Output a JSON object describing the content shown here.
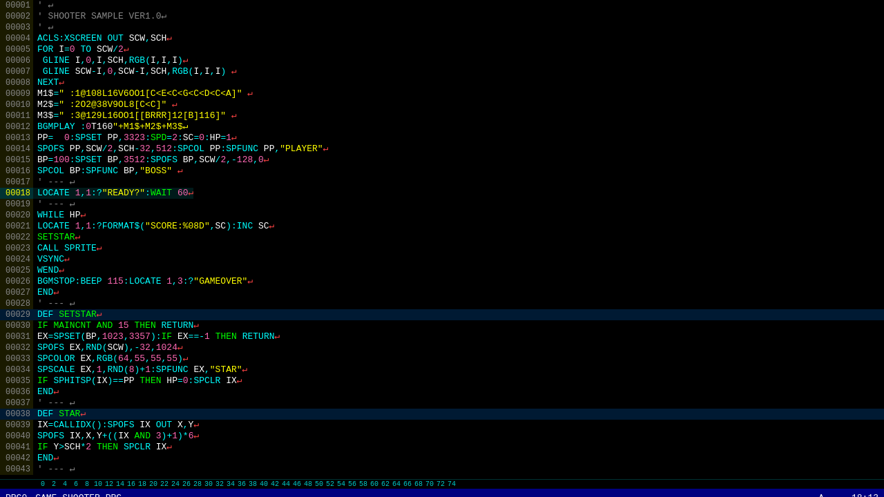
{
  "editor": {
    "title": "GAME_SHOOTER.PRG",
    "program": "PRG0",
    "cursor": {
      "line": 18,
      "col": 13
    },
    "status_right": "A",
    "time": "18:13"
  },
  "ruler": {
    "marks": [
      "0",
      "2",
      "4",
      "6",
      "8",
      "10",
      "12",
      "14",
      "16",
      "18",
      "20",
      "22",
      "24",
      "26",
      "28",
      "30",
      "32",
      "34",
      "36",
      "38",
      "40",
      "42",
      "44",
      "46",
      "48",
      "50",
      "52",
      "54",
      "56",
      "58",
      "60",
      "62",
      "64",
      "66",
      "68",
      "70",
      "72",
      "74"
    ]
  },
  "lines": [
    {
      "num": "00001",
      "content": "' ↵",
      "highlight": false,
      "def": false
    },
    {
      "num": "2",
      "content": "' SHOOTER SAMPLE VER1.0↵",
      "highlight": false,
      "def": false
    },
    {
      "num": "3",
      "content": "' ↵",
      "highlight": false,
      "def": false
    },
    {
      "num": "4",
      "content": "ACLS:XSCREEN OUT SCW,SCH↵",
      "highlight": false,
      "def": false
    },
    {
      "num": "5",
      "content": "FOR I=0 TO SCW/2↵",
      "highlight": false,
      "def": false
    },
    {
      "num": "6",
      "content": " GLINE I,0,I,SCH,RGB(I,I,I)↵",
      "highlight": false,
      "def": false
    },
    {
      "num": "7",
      "content": " GLINE SCW-I,0,SCW-I,SCH,RGB(I,I,I) ↵",
      "highlight": false,
      "def": false
    },
    {
      "num": "8",
      "content": "NEXT↵",
      "highlight": false,
      "def": false
    },
    {
      "num": "9",
      "content": "M1$=\" :1@108L16V6OO1[C<E<C<G<C<D<C<A]\" ↵",
      "highlight": false,
      "def": false
    },
    {
      "num": "10",
      "content": "M2$=\" :2O2@38V9OL8[C<C]\" ↵",
      "highlight": false,
      "def": false
    },
    {
      "num": "11",
      "content": "M3$=\" :3@129L16OO1[[BRRR]12[B]116]\" ↵",
      "highlight": false,
      "def": false
    },
    {
      "num": "12",
      "content": "BGMPLAY :0T160\"+M1$+M2$+M3$↵",
      "highlight": false,
      "def": false
    },
    {
      "num": "13",
      "content": "PP=  0:SPSET PP,3323:SPD=2:SC=0:HP=1↵",
      "highlight": false,
      "def": false
    },
    {
      "num": "14",
      "content": "SPOFS PP,SCW/2,SCH-32,512:SPCOL PP:SPFUNC PP,\"PLAYER\"↵",
      "highlight": false,
      "def": false
    },
    {
      "num": "15",
      "content": "BP=100:SPSET BP,3512:SPOFS BP,SCW/2,-128,0↵",
      "highlight": false,
      "def": false
    },
    {
      "num": "16",
      "content": "SPCOL BP:SPFUNC BP,\"BOSS\" ↵",
      "highlight": false,
      "def": false
    },
    {
      "num": "17",
      "content": "' --- ↵",
      "highlight": false,
      "def": false
    },
    {
      "num": "18",
      "content": "LOCATE 1,1:?\"READY?\":WAIT 60↵",
      "highlight": true,
      "def": false
    },
    {
      "num": "19",
      "content": "' --- ↵",
      "highlight": false,
      "def": false
    },
    {
      "num": "20",
      "content": "WHILE HP↵",
      "highlight": false,
      "def": false
    },
    {
      "num": "21",
      "content": "LOCATE 1,1:?FORMAT$(\"SCORE:%08D\",SC):INC SC↵",
      "highlight": false,
      "def": false
    },
    {
      "num": "22",
      "content": "SETSTAR↵",
      "highlight": false,
      "def": false
    },
    {
      "num": "23",
      "content": "CALL SPRITE↵",
      "highlight": false,
      "def": false
    },
    {
      "num": "24",
      "content": "VSYNC↵",
      "highlight": false,
      "def": false
    },
    {
      "num": "25",
      "content": "WEND↵",
      "highlight": false,
      "def": false
    },
    {
      "num": "26",
      "content": "BGMSTOP:BEEP 115:LOCATE 1,3:?\"GAMEOVER\"↵",
      "highlight": false,
      "def": false
    },
    {
      "num": "27",
      "content": "END↵",
      "highlight": false,
      "def": false
    },
    {
      "num": "28",
      "content": "' --- ↵",
      "highlight": false,
      "def": false
    },
    {
      "num": "29",
      "content": "DEF SETSTAR↵",
      "highlight": false,
      "def": true
    },
    {
      "num": "30",
      "content": "IF MAINCNT AND 15 THEN RETURN↵",
      "highlight": false,
      "def": false
    },
    {
      "num": "31",
      "content": "EX=SPSET(BP,1023,3357):IF EX==-1 THEN RETURN↵",
      "highlight": false,
      "def": false
    },
    {
      "num": "32",
      "content": "SPOFS EX,RND(SCW),-32,1024↵",
      "highlight": false,
      "def": false
    },
    {
      "num": "33",
      "content": "SPCOLOR EX,RGB(64,55,55,55)↵",
      "highlight": false,
      "def": false
    },
    {
      "num": "34",
      "content": "SPSCALE EX,1,RND(8)+1:SPFUNC EX,\"STAR\"↵",
      "highlight": false,
      "def": false
    },
    {
      "num": "35",
      "content": "IF SPHITSP(IX)==PP THEN HP=0:SPCLR IX↵",
      "highlight": false,
      "def": false
    },
    {
      "num": "36",
      "content": "END↵",
      "highlight": false,
      "def": false
    },
    {
      "num": "37",
      "content": "' --- ↵",
      "highlight": false,
      "def": false
    },
    {
      "num": "38",
      "content": "DEF STAR↵",
      "highlight": false,
      "def": true
    },
    {
      "num": "39",
      "content": "IX=CALLIDX():SPOFS IX OUT X,Y↵",
      "highlight": false,
      "def": false
    },
    {
      "num": "40",
      "content": "SPOFS IX,X,Y+((IX AND 3)+1)*6↵",
      "highlight": false,
      "def": false
    },
    {
      "num": "41",
      "content": "IF Y>SCH*2 THEN SPCLR IX↵",
      "highlight": false,
      "def": false
    },
    {
      "num": "42",
      "content": "END↵",
      "highlight": false,
      "def": false
    },
    {
      "num": "43",
      "content": "' --- ↵",
      "highlight": false,
      "def": false
    }
  ]
}
